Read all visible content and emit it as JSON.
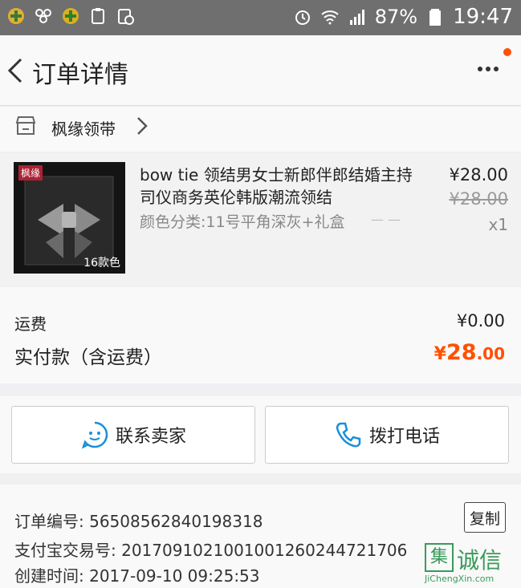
{
  "status_bar": {
    "battery": "87%",
    "time": "19:47"
  },
  "header": {
    "title": "订单详情"
  },
  "shop": {
    "name": "枫缘领带"
  },
  "product": {
    "thumb_badge": "枫缘",
    "thumb_count": "16款色",
    "title": "bow tie 领结男女士新郎伴郎结婚主持司仪商务英伦韩版潮流领结",
    "sku": "颜色分类:11号平角深灰+礼盒",
    "price": "¥28.00",
    "original_price": "¥28.00",
    "quantity": "x1"
  },
  "fees": {
    "shipping_label": "运费",
    "shipping_value": "¥0.00",
    "paid_label": "实付款（含运费）",
    "paid_currency": "¥",
    "paid_integer": "28",
    "paid_decimal": ".00"
  },
  "actions": {
    "contact_label": "联系卖家",
    "call_label": "拨打电话"
  },
  "order_info": {
    "order_no": "订单编号: 56508562840198318",
    "alipay_no": "支付宝交易号: 2017091021001001260244721706",
    "created": "创建时间: 2017-09-10 09:25:53",
    "copy_label": "复制"
  },
  "watermark": {
    "logo": "集",
    "name": "诚信",
    "url": "JiChengXin.com"
  },
  "colors": {
    "accent": "#ff5000",
    "call_blue": "#1a8fd8",
    "status_bar": "#6f6f6f"
  }
}
